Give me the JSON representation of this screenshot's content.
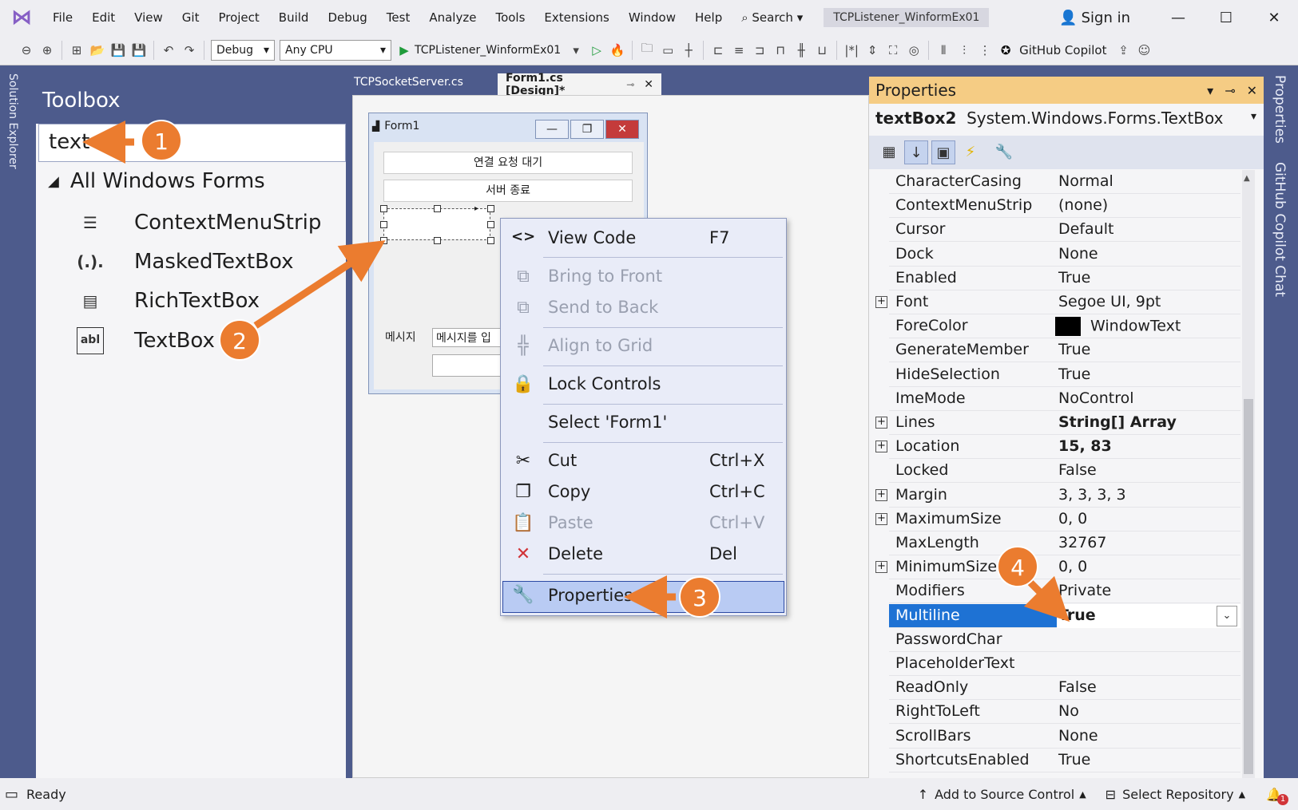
{
  "menubar": {
    "logo": "⋈",
    "items": [
      "File",
      "Edit",
      "View",
      "Git",
      "Project",
      "Build",
      "Debug",
      "Test",
      "Analyze",
      "Tools",
      "Extensions",
      "Window",
      "Help"
    ],
    "search": "Search",
    "search_icon": "⌕",
    "project": "TCPListener_WinformEx01",
    "sign_in": "Sign in"
  },
  "toolbar": {
    "config": "Debug",
    "platform": "Any CPU",
    "start_target": "TCPListener_WinformEx01",
    "copilot": "GitHub Copilot"
  },
  "solution_explorer_label": "Solution Explorer",
  "toolbox": {
    "title": "Toolbox",
    "search_value": "text",
    "group": "All Windows Forms",
    "items": [
      {
        "label": "ContextMenuStrip",
        "icon": "☰"
      },
      {
        "label": "MaskedTextBox",
        "icon": "(.)."
      },
      {
        "label": "RichTextBox",
        "icon": "▤"
      },
      {
        "label": "TextBox",
        "icon": "abl"
      }
    ]
  },
  "tabs": [
    {
      "label": "TCPSocketServer.cs"
    },
    {
      "label": "Form1.cs [Design]*"
    }
  ],
  "form": {
    "title": "Form1",
    "btn_wait": "연결 요청 대기",
    "btn_stop": "서버 종료",
    "msg_label": "메시지",
    "msg_input": "메시지를 입"
  },
  "context_menu": {
    "items": [
      {
        "label": "View Code",
        "key": "F7",
        "icon": "<>"
      },
      {
        "label": "Bring to Front",
        "key": "",
        "icon": "⧉"
      },
      {
        "label": "Send to Back",
        "key": "",
        "icon": "⧉"
      },
      {
        "label": "Align to Grid",
        "key": "",
        "icon": "╬"
      },
      {
        "label": "Lock Controls",
        "key": "",
        "icon": "🔒"
      },
      {
        "label": "Select 'Form1'",
        "key": "",
        "icon": ""
      },
      {
        "label": "Cut",
        "key": "Ctrl+X",
        "icon": "✂"
      },
      {
        "label": "Copy",
        "key": "Ctrl+C",
        "icon": "❐"
      },
      {
        "label": "Paste",
        "key": "Ctrl+V",
        "icon": "📋"
      },
      {
        "label": "Delete",
        "key": "Del",
        "icon": "✕"
      },
      {
        "label": "Properties",
        "key": "",
        "icon": "🔧"
      }
    ]
  },
  "properties": {
    "title": "Properties",
    "object_name": "textBox2",
    "object_type": "System.Windows.Forms.TextBox",
    "rows": [
      {
        "name": "CharacterCasing",
        "value": "Normal"
      },
      {
        "name": "ContextMenuStrip",
        "value": "(none)"
      },
      {
        "name": "Cursor",
        "value": "Default"
      },
      {
        "name": "Dock",
        "value": "None"
      },
      {
        "name": "Enabled",
        "value": "True"
      },
      {
        "name": "Font",
        "value": "Segoe UI, 9pt"
      },
      {
        "name": "ForeColor",
        "value": "WindowText"
      },
      {
        "name": "GenerateMember",
        "value": "True"
      },
      {
        "name": "HideSelection",
        "value": "True"
      },
      {
        "name": "ImeMode",
        "value": "NoControl"
      },
      {
        "name": "Lines",
        "value": "String[] Array"
      },
      {
        "name": "Location",
        "value": "15, 83"
      },
      {
        "name": "Locked",
        "value": "False"
      },
      {
        "name": "Margin",
        "value": "3, 3, 3, 3"
      },
      {
        "name": "MaximumSize",
        "value": "0, 0"
      },
      {
        "name": "MaxLength",
        "value": "32767"
      },
      {
        "name": "MinimumSize",
        "value": "0, 0"
      },
      {
        "name": "Modifiers",
        "value": "Private"
      },
      {
        "name": "Multiline",
        "value": "True"
      },
      {
        "name": "PasswordChar",
        "value": ""
      },
      {
        "name": "PlaceholderText",
        "value": ""
      },
      {
        "name": "ReadOnly",
        "value": "False"
      },
      {
        "name": "RightToLeft",
        "value": "No"
      },
      {
        "name": "ScrollBars",
        "value": "None"
      },
      {
        "name": "ShortcutsEnabled",
        "value": "True"
      }
    ]
  },
  "right_labels": [
    "Properties",
    "GitHub Copilot Chat"
  ],
  "status": {
    "ready": "Ready",
    "source_control": "Add to Source Control",
    "repository": "Select Repository",
    "notif_count": "1"
  },
  "badges": [
    "1",
    "2",
    "3",
    "4"
  ],
  "colors": {
    "accent": "#eb7c2f",
    "selection": "#1e72d4",
    "panel_header": "#f5cc84"
  }
}
